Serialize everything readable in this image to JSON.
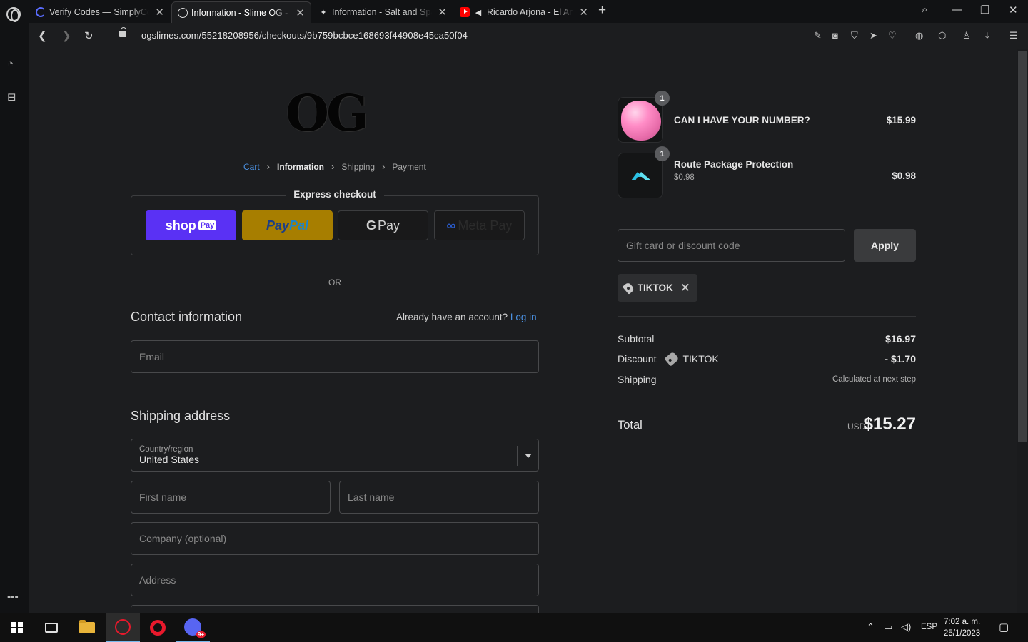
{
  "browser": {
    "tabs": [
      {
        "title": "Verify Codes — SimplyCodes",
        "active": false
      },
      {
        "title": "Information - Slime OG - Checkout",
        "active": true
      },
      {
        "title": "Information - Salt and Sparkle",
        "active": false
      },
      {
        "title": "Ricardo Arjona - El Amor",
        "active": false
      }
    ],
    "url": "ogslimes.com/55218208956/checkouts/9b759bcbce168693f44908e45ca50f04"
  },
  "checkout": {
    "logo_text": "OG",
    "breadcrumb": {
      "cart": "Cart",
      "information": "Information",
      "shipping": "Shipping",
      "payment": "Payment"
    },
    "express_title": "Express checkout",
    "express": {
      "shop": "shop",
      "shop_tag": "Pay",
      "paypal_1": "Pay",
      "paypal_2": "Pal",
      "gpay_g": "G",
      "gpay": "Pay",
      "meta_symbol": "∞",
      "meta": "Meta Pay"
    },
    "or_text": "OR",
    "contact": {
      "title": "Contact information",
      "account_prompt": "Already have an account?",
      "login": "Log in",
      "email_placeholder": "Email"
    },
    "shipping_address": {
      "title": "Shipping address",
      "country_label": "Country/region",
      "country_value": "United States",
      "first_name_placeholder": "First name",
      "last_name_placeholder": "Last name",
      "company_placeholder": "Company (optional)",
      "address_placeholder": "Address"
    }
  },
  "summary": {
    "items": [
      {
        "name": "CAN I HAVE YOUR NUMBER?",
        "quantity": "1",
        "price": "$15.99",
        "sub": ""
      },
      {
        "name": "Route Package Protection",
        "quantity": "1",
        "price": "$0.98",
        "sub": "$0.98"
      }
    ],
    "discount_placeholder": "Gift card or discount code",
    "apply_label": "Apply",
    "applied_code": "TIKTOK",
    "subtotal_label": "Subtotal",
    "subtotal_value": "$16.97",
    "discount_label": "Discount",
    "discount_code": "TIKTOK",
    "discount_value": "- $1.70",
    "shipping_label": "Shipping",
    "shipping_value": "Calculated at next step",
    "total_label": "Total",
    "total_currency": "USD",
    "total_value": "$15.27"
  },
  "taskbar": {
    "language": "ESP",
    "time": "7:02 a. m.",
    "date": "25/1/2023"
  },
  "colors": {
    "shop_pay": "#5a31f4",
    "paypal": "#a77e00",
    "link": "#4b91e2",
    "background": "#1c1d1f"
  }
}
